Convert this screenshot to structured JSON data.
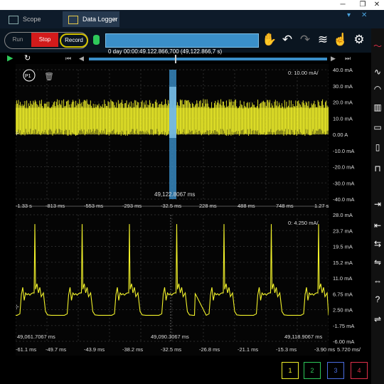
{
  "window": {
    "minimize": "─",
    "restore": "❐",
    "close": "✕"
  },
  "tabs": [
    {
      "label": "Scope"
    },
    {
      "label": "Data Logger"
    }
  ],
  "tab_close": "×",
  "tab_controls": {
    "pin": "▾",
    "add": "✕"
  },
  "toolbar": {
    "run": "Run",
    "stop": "Stop",
    "record": "Record",
    "progress": ""
  },
  "timestamp": "0 day 00:00:49.122.866,700 (49,122.866,7 s)",
  "channels": [
    "1",
    "2",
    "3",
    "4"
  ],
  "colors": {
    "trace": "#f0f02a",
    "accent": "#3a8fc9",
    "stop": "#d21b1b",
    "ch1": "#f0f02a",
    "ch2": "#2ec95a",
    "ch3": "#4a6de0",
    "ch4": "#e0304a"
  },
  "top_panel": {
    "badge": "P1",
    "scale": "10.00 mA/",
    "scale_prefix": "0:",
    "y_ticks": [
      "40.0 mA",
      "30.0 mA",
      "20.0 mA",
      "10.0 mA",
      "0.00 A",
      "-10.0 mA",
      "-20.0 mA",
      "-30.0 mA",
      "-40.0 mA"
    ],
    "x_ticks": [
      "-1.33 s",
      "-813 ms",
      "-553 ms",
      "-293 ms",
      "-32.5 ms",
      "228 ms",
      "488 ms",
      "748 ms",
      "1.27 s"
    ],
    "cursor_label": "49,122.8067 ms"
  },
  "bottom_panel": {
    "scale": "4.250 mA/",
    "scale_prefix": "0:",
    "y_ticks": [
      "28.0 mA",
      "23.7 mA",
      "19.5 mA",
      "15.2 mA",
      "11.0 mA",
      "6.75 mA",
      "2.50 mA",
      "-1.75 mA",
      "-6.00 mA"
    ],
    "x_ticks": [
      "-61.1 ms",
      "-49.7 ms",
      "-43.9 ms",
      "-38.2 ms",
      "-32.5 ms",
      "-26.8 ms",
      "-21.1 ms",
      "-15.3 ms",
      "-3.90 ms"
    ],
    "x_tick_last": "5.720 ms/",
    "time_labels": [
      "49,061.7067 ms",
      "49,090.3067 ms",
      "49,118.9067 ms"
    ]
  },
  "icons": {
    "hand": "✋",
    "undo": "↶",
    "redo": "↷",
    "waveform": "≋",
    "touch": "☝",
    "gear": "⚙",
    "play": "▶",
    "refresh": "↻",
    "first": "⏮",
    "prev": "◀",
    "next": "▶",
    "last": "⏭",
    "trash": "🗑",
    "side": [
      "〜",
      "∿",
      "◠",
      "▥",
      "▭",
      "▯",
      "⊓",
      "⇥",
      "⇤",
      "⇆",
      "⇋",
      "⇔",
      "?",
      "⇌"
    ]
  }
}
